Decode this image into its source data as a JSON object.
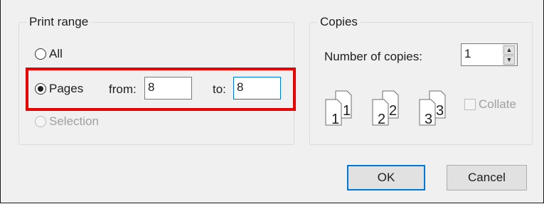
{
  "print_range": {
    "legend": "Print range",
    "option_all": "All",
    "option_pages": "Pages",
    "option_selection": "Selection",
    "selected": "Pages",
    "from_label": "from:",
    "from_value": "8",
    "to_label": "to:",
    "to_value": "8"
  },
  "copies": {
    "legend": "Copies",
    "number_label": "Number of copies:",
    "number_value": "1",
    "collate_label": "Collate",
    "collate_checked": false,
    "collate_enabled": false,
    "page_icons": [
      {
        "back": "1",
        "front": "1"
      },
      {
        "back": "2",
        "front": "2"
      },
      {
        "back": "3",
        "front": "3"
      }
    ]
  },
  "buttons": {
    "ok": "OK",
    "cancel": "Cancel"
  },
  "colors": {
    "highlight": "#e60000",
    "focus": "#0078d7",
    "dialog_bg": "#f0f0f0"
  }
}
